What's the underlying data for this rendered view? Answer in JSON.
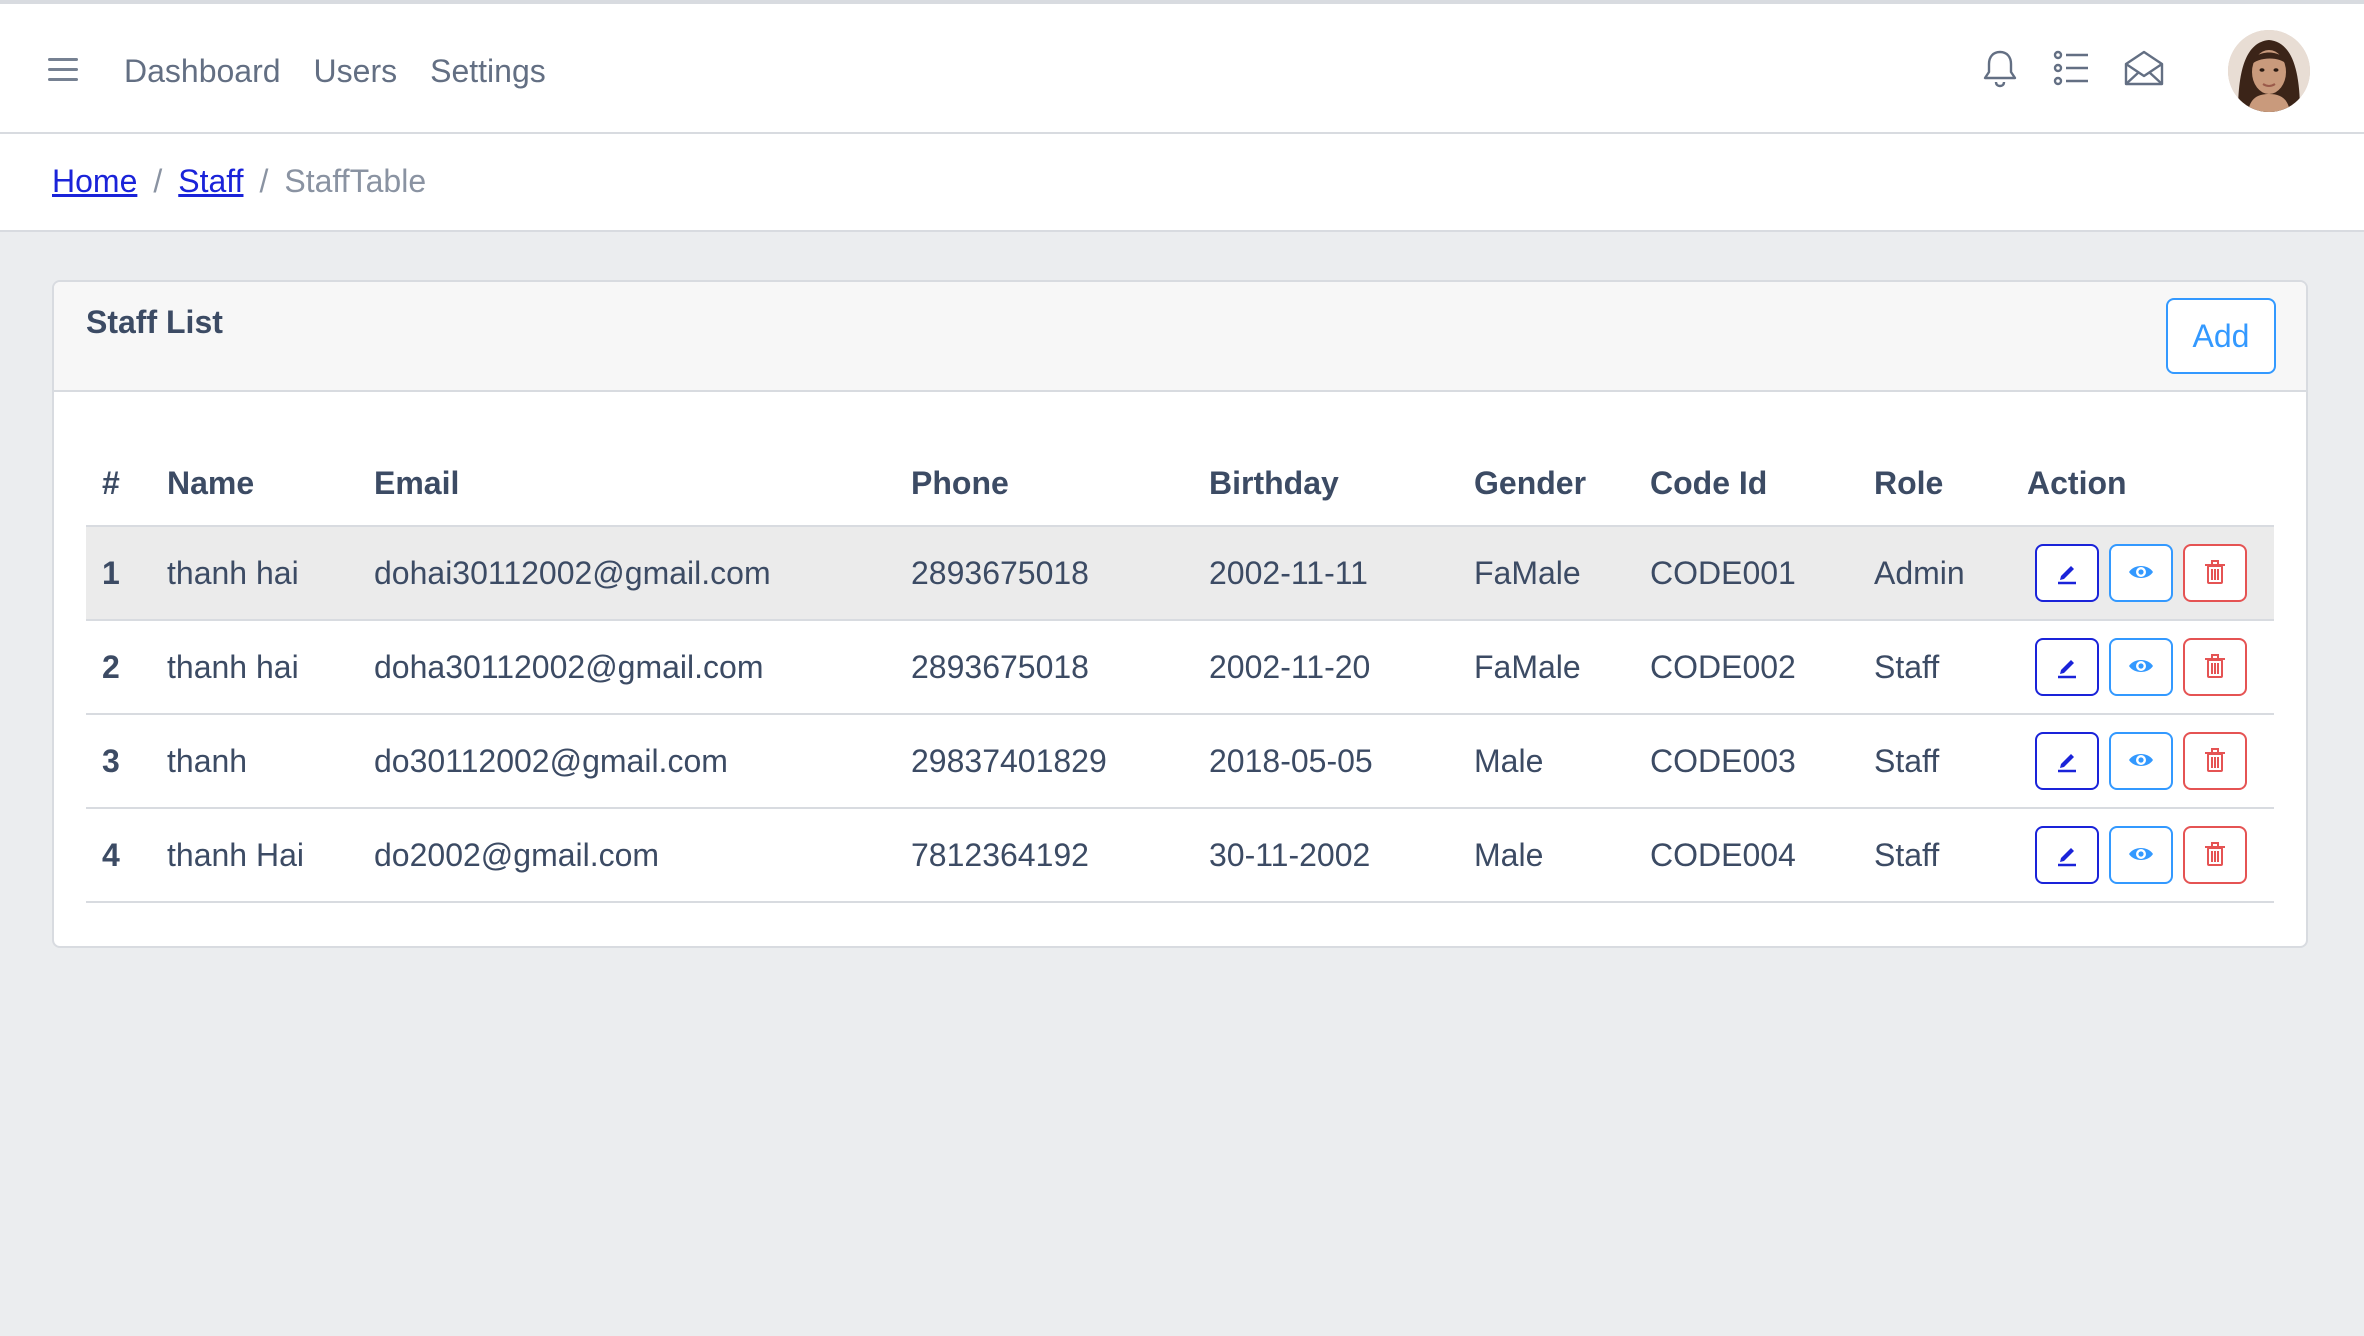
{
  "nav": [
    "Dashboard",
    "Users",
    "Settings"
  ],
  "header_icons": [
    "bell-icon",
    "list-icon",
    "envelope-open-icon"
  ],
  "breadcrumb": {
    "home": "Home",
    "staff": "Staff",
    "current": "StaffTable"
  },
  "card": {
    "title": "Staff List",
    "add_label": "Add"
  },
  "table": {
    "headers": [
      "#",
      "Name",
      "Email",
      "Phone",
      "Birthday",
      "Gender",
      "Code Id",
      "Role",
      "Action"
    ],
    "rows": [
      [
        "1",
        "thanh hai",
        "dohai30112002@gmail.com",
        "2893675018",
        "2002-11-11",
        "FaMale",
        "CODE001",
        "Admin"
      ],
      [
        "2",
        "thanh hai",
        "doha30112002@gmail.com",
        "2893675018",
        "2002-11-20",
        "FaMale",
        "CODE002",
        "Staff"
      ],
      [
        "3",
        "thanh",
        "do30112002@gmail.com",
        "29837401829",
        "2018-05-05",
        "Male",
        "CODE003",
        "Staff"
      ],
      [
        "4",
        "thanh Hai",
        "do2002@gmail.com",
        "7812364192",
        "30-11-2002",
        "Male",
        "CODE004",
        "Staff"
      ]
    ]
  },
  "colors": {
    "edit": "#1a23d9",
    "view": "#3399ff",
    "delete": "#e55353",
    "highlight_row": "#ebebeb"
  }
}
